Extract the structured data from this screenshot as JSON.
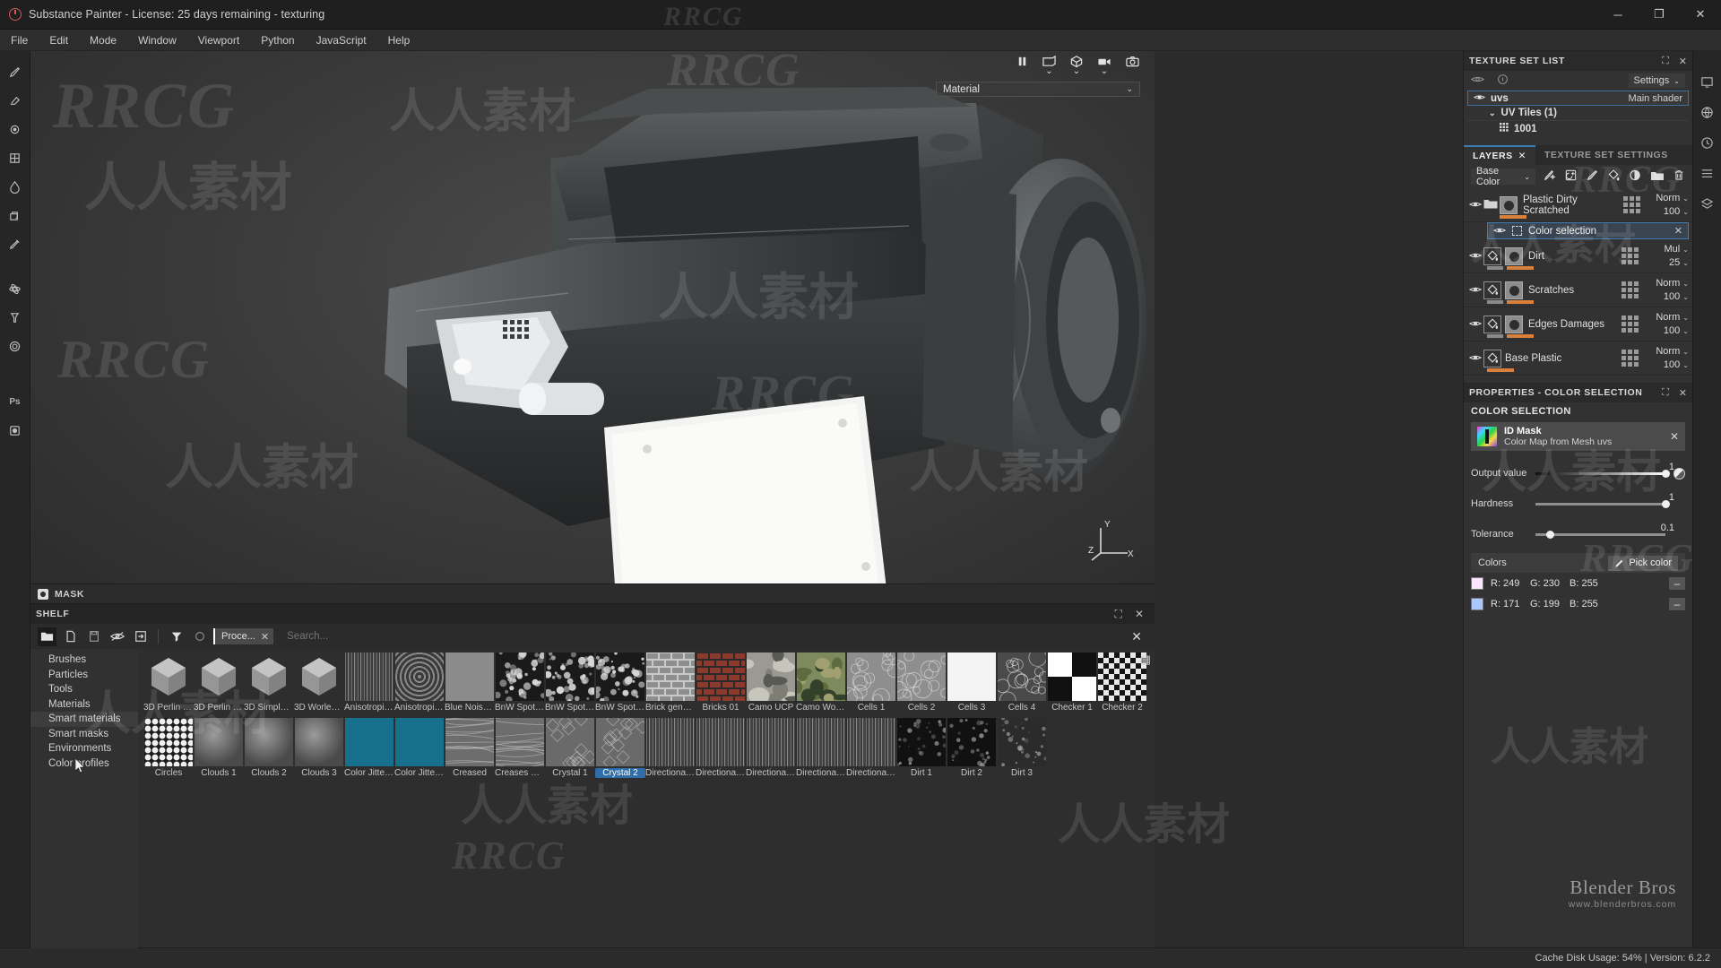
{
  "window": {
    "title": "Substance Painter - License: 25 days remaining - texturing",
    "minimize": "─",
    "maximize": "❐",
    "close": "✕"
  },
  "menubar": {
    "items": [
      "File",
      "Edit",
      "Mode",
      "Window",
      "Viewport",
      "Python",
      "JavaScript",
      "Help"
    ]
  },
  "left_toolbar": {
    "items": [
      {
        "name": "paint-brush-tool"
      },
      {
        "name": "eraser-tool"
      },
      {
        "name": "projection-tool"
      },
      {
        "name": "polygon-fill-tool"
      },
      {
        "name": "smudge-tool"
      },
      {
        "name": "clone-tool"
      },
      {
        "name": "material-picker-tool"
      },
      {
        "name": "physics-tool"
      },
      {
        "name": "particles-tool"
      },
      {
        "name": "settings-tool"
      },
      {
        "name": "photoshop-link",
        "label": "Ps"
      },
      {
        "name": "bake-tool"
      }
    ]
  },
  "viewport": {
    "toolbar_icons": [
      "pause-icon",
      "view-2d-icon",
      "view-3d-icon",
      "camera-view-icon",
      "screenshot-icon"
    ],
    "material_dropdown": {
      "value": "Material"
    },
    "axis_labels": {
      "x": "X",
      "y": "Y",
      "z": "Z"
    }
  },
  "mask_bar": {
    "label": "MASK"
  },
  "shelf": {
    "title": "SHELF",
    "header_actions": [
      "maximize-icon",
      "close-icon"
    ],
    "tools": [
      "open-folder-icon",
      "new-file-icon",
      "save-icon",
      "hide-icon",
      "import-icon",
      "filter-icon",
      "refresh-icon"
    ],
    "filter_chip": {
      "label": "Proce...",
      "close": "✕"
    },
    "search": {
      "placeholder": "Search...",
      "value": "",
      "clear": "✕"
    },
    "categories": [
      {
        "label": "Brushes",
        "selected": false
      },
      {
        "label": "Particles",
        "selected": false
      },
      {
        "label": "Tools",
        "selected": false
      },
      {
        "label": "Materials",
        "selected": false
      },
      {
        "label": "Smart materials",
        "selected": true
      },
      {
        "label": "Smart masks",
        "selected": false
      },
      {
        "label": "Environments",
        "selected": false
      },
      {
        "label": "Color profiles",
        "selected": false
      }
    ],
    "items": [
      {
        "label": "3D Perlin N...",
        "kind": "noise-cube"
      },
      {
        "label": "3D Perlin N...",
        "kind": "noise-cube"
      },
      {
        "label": "3D Simplex ...",
        "kind": "noise-cube"
      },
      {
        "label": "3D Worley ...",
        "kind": "noise-cube"
      },
      {
        "label": "Anisotropic ...",
        "kind": "streaks"
      },
      {
        "label": "Anisotropic ...",
        "kind": "rings"
      },
      {
        "label": "Blue Noise ...",
        "kind": "flat-grey"
      },
      {
        "label": "BnW Spots 1",
        "kind": "spots"
      },
      {
        "label": "BnW Spots 2",
        "kind": "spots"
      },
      {
        "label": "BnW Spots 3",
        "kind": "spots"
      },
      {
        "label": "Brick gener...",
        "kind": "bricks-light"
      },
      {
        "label": "Bricks 01",
        "kind": "bricks-dark"
      },
      {
        "label": "Camo UCP",
        "kind": "camo-grey"
      },
      {
        "label": "Camo Woo...",
        "kind": "camo-green"
      },
      {
        "label": "Cells 1",
        "kind": "cells"
      },
      {
        "label": "Cells 2",
        "kind": "cells"
      },
      {
        "label": "Cells 3",
        "kind": "white"
      },
      {
        "label": "Cells 4",
        "kind": "cells-dark"
      },
      {
        "label": "Checker 1",
        "kind": "checker-big"
      },
      {
        "label": "Checker 2",
        "kind": "checker-fine"
      },
      {
        "label": "Circles",
        "kind": "circles"
      },
      {
        "label": "Clouds 1",
        "kind": "clouds"
      },
      {
        "label": "Clouds 2",
        "kind": "clouds"
      },
      {
        "label": "Clouds 3",
        "kind": "clouds"
      },
      {
        "label": "Color Jitter (...",
        "kind": "teal"
      },
      {
        "label": "Color Jitter (...",
        "kind": "teal"
      },
      {
        "label": "Creased",
        "kind": "creases"
      },
      {
        "label": "Creases Soft",
        "kind": "creases"
      },
      {
        "label": "Crystal 1",
        "kind": "crystal"
      },
      {
        "label": "Crystal 2",
        "kind": "crystal",
        "selected": true
      },
      {
        "label": "Directional ...",
        "kind": "streaks"
      },
      {
        "label": "Directional ...",
        "kind": "streaks"
      },
      {
        "label": "Directional ...",
        "kind": "streaks"
      },
      {
        "label": "Directional ...",
        "kind": "streaks"
      },
      {
        "label": "Directional ...",
        "kind": "streaks"
      },
      {
        "label": "Dirt 1",
        "kind": "dirt-dark"
      },
      {
        "label": "Dirt 2",
        "kind": "dirt-dark"
      },
      {
        "label": "Dirt 3",
        "kind": "dirt"
      }
    ]
  },
  "texture_set_list": {
    "title": "TEXTURE SET LIST",
    "settings_label": "Settings",
    "set_name": "uvs",
    "shader_label": "Main shader",
    "uv_tiles_label": "UV Tiles (1)",
    "tile": "1001"
  },
  "panel_tabs": {
    "layers": "LAYERS",
    "texture_set_settings": "TEXTURE SET SETTINGS",
    "close": "✕"
  },
  "layers_panel": {
    "channel_select": "Base Color",
    "tool_icons": [
      "add-effect-icon",
      "add-fill-layer-icon",
      "add-paint-layer-icon",
      "add-fill-icon",
      "add-mask-icon",
      "add-folder-icon",
      "delete-icon"
    ],
    "selected_effect": {
      "name": "Color selection",
      "close": "✕"
    },
    "layers": [
      {
        "name": "Plastic Dirty Scratched",
        "blend": "Norm",
        "opacity": "100",
        "type": "folder"
      },
      {
        "name": "Dirt",
        "blend": "Mul",
        "opacity": "25",
        "type": "fill"
      },
      {
        "name": "Scratches",
        "blend": "Norm",
        "opacity": "100",
        "type": "fill"
      },
      {
        "name": "Edges Damages",
        "blend": "Norm",
        "opacity": "100",
        "type": "fill"
      },
      {
        "name": "Base Plastic",
        "blend": "Norm",
        "opacity": "100",
        "type": "fill"
      }
    ]
  },
  "properties_panel": {
    "title": "PROPERTIES - COLOR SELECTION",
    "section": "COLOR SELECTION",
    "id_mask": {
      "name": "ID Mask",
      "subtitle": "Color Map from Mesh uvs",
      "close": "✕"
    },
    "sliders": [
      {
        "label": "Output value",
        "value": "1",
        "pct": 100
      },
      {
        "label": "Hardness",
        "value": "1",
        "pct": 100
      },
      {
        "label": "Tolerance",
        "value": "0.1",
        "pct": 11
      }
    ],
    "colors_label": "Colors",
    "pick_color": "Pick color",
    "colors": [
      {
        "r": "R: 249",
        "g": "G: 230",
        "b": "B: 255",
        "hex": "#f9e6ff",
        "minus": "–"
      },
      {
        "r": "R: 171",
        "g": "G: 199",
        "b": "B: 255",
        "hex": "#abc7ff",
        "minus": "–"
      }
    ]
  },
  "branding": {
    "line1": "Blender Bros",
    "line2": "www.blenderbros.com"
  },
  "statusbar": {
    "right": "Cache Disk Usage:   54% | Version: 6.2.2"
  },
  "watermarks": {
    "latin": "RRCG",
    "cjk": "人人素材"
  }
}
